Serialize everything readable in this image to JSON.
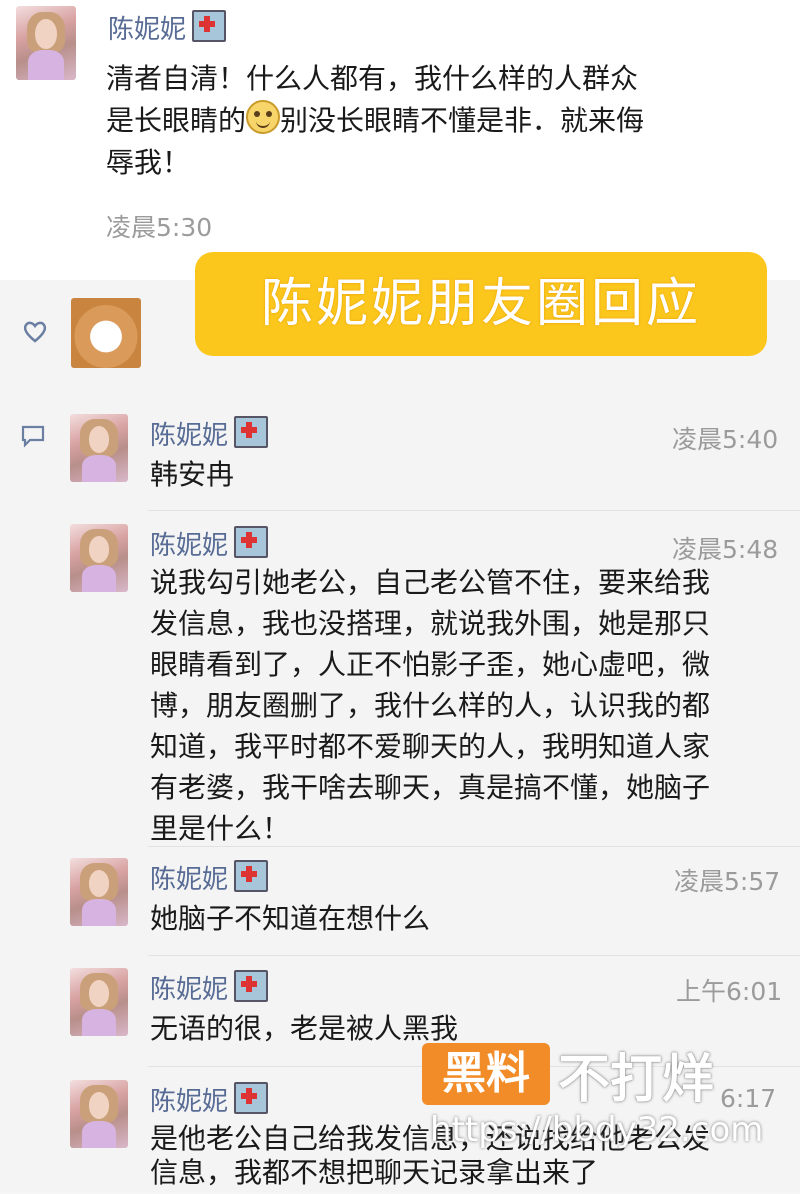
{
  "post": {
    "author": "陈妮妮",
    "text_line1": "清者自清！什么人都有，我什么样的人群众",
    "text_line2_a": "是长眼睛的",
    "text_line2_b": "别没长眼睛不懂是非．就来侮",
    "text_line3": "辱我！",
    "time": "凌晨5:30"
  },
  "banner": {
    "label": "陈妮妮朋友圈回应"
  },
  "comments": [
    {
      "author": "陈妮妮",
      "time": "凌晨5:40",
      "lines": [
        "韩安冉"
      ]
    },
    {
      "author": "陈妮妮",
      "time": "凌晨5:48",
      "lines": [
        "说我勾引她老公，自己老公管不住，要来给我",
        "发信息，我也没搭理，就说我外围，她是那只",
        "眼睛看到了，人正不怕影子歪，她心虚吧，微",
        "博，朋友圈删了，我什么样的人，认识我的都",
        "知道，我平时都不爱聊天的人，我明知道人家",
        "有老婆，我干啥去聊天，真是搞不懂，她脑子",
        "里是什么！"
      ]
    },
    {
      "author": "陈妮妮",
      "time": "凌晨5:57",
      "lines": [
        "她脑子不知道在想什么"
      ]
    },
    {
      "author": "陈妮妮",
      "time": "上午6:01",
      "lines": [
        "无语的很，老是被人黑我"
      ]
    },
    {
      "author": "陈妮妮",
      "time": "6:17",
      "lines": [
        "是他老公自己给我发信息，还说找给他老公发",
        "信息，我都不想把聊天记录拿出来了"
      ]
    }
  ],
  "watermark": {
    "box": "黑料",
    "text": "不打烊",
    "url": "https://bbdy32.com"
  },
  "icons": {
    "like": "heart-outline-icon",
    "comment": "comment-bubble-icon"
  },
  "colors": {
    "name": "#576b95",
    "banner": "#fbc71d",
    "watermark": "#f28c28"
  }
}
